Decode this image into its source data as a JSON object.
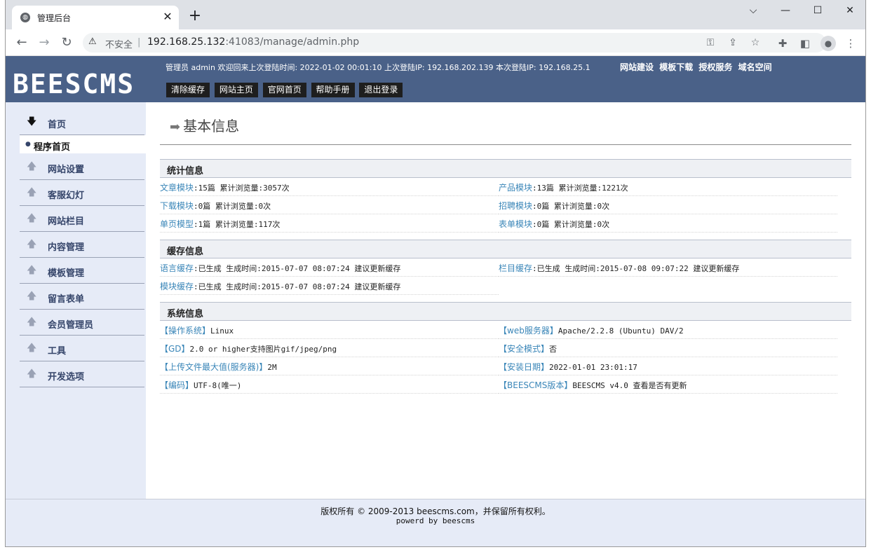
{
  "browser": {
    "tab_title": "管理后台",
    "new_tab": "+",
    "close_tab": "✕",
    "not_secure": "不安全",
    "url_host": "192.168.25.132",
    "url_rest": ":41083/manage/admin.php"
  },
  "header": {
    "logo": "BEESCMS",
    "welcome": "管理员 admin 欢迎回来上次登陆时间: 2022-01-02 00:01:10 上次登陆IP: 192.168.202.139 本次登陆IP: 192.168.25.1",
    "top_links": [
      "网站建设",
      "模板下载",
      "授权服务",
      "域名空间"
    ],
    "buttons": [
      "清除缓存",
      "网站主页",
      "官网首页",
      "帮助手册",
      "退出登录"
    ]
  },
  "sidebar": {
    "home": "首页",
    "sub_active": "程序首页",
    "items": [
      "网站设置",
      "客服幻灯",
      "网站栏目",
      "内容管理",
      "模板管理",
      "留言表单",
      "会员管理员",
      "工具",
      "开发选项"
    ]
  },
  "main": {
    "title": "基本信息",
    "stats": {
      "heading": "统计信息",
      "rows": [
        {
          "k": "文章模块",
          "v": ":15篇  累计浏览量:3057次"
        },
        {
          "k": "产品模块",
          "v": ":13篇  累计浏览量:1221次"
        },
        {
          "k": "下载模块",
          "v": ":0篇  累计浏览量:0次"
        },
        {
          "k": "招聘模块",
          "v": ":0篇  累计浏览量:0次"
        },
        {
          "k": "单页模型",
          "v": ":1篇  累计浏览量:117次"
        },
        {
          "k": "表单模块",
          "v": ":0篇  累计浏览量:0次"
        }
      ]
    },
    "cache": {
      "heading": "缓存信息",
      "rows": [
        {
          "k": "语言缓存",
          "v": ":已生成     生成时间:2015-07-07 08:07:24  建议更新缓存"
        },
        {
          "k": "栏目缓存",
          "v": ":已生成     生成时间:2015-07-08 09:07:22  建议更新缓存"
        },
        {
          "k": "模块缓存",
          "v": ":已生成     生成时间:2015-07-07 08:07:24  建议更新缓存"
        }
      ]
    },
    "system": {
      "heading": "系统信息",
      "rows": [
        {
          "k": "【操作系统】",
          "v": "Linux"
        },
        {
          "k": "【web服务器】",
          "v": "Apache/2.2.8 (Ubuntu) DAV/2"
        },
        {
          "k": "【GD】",
          "v": "2.0 or higher支持图片gif/jpeg/png"
        },
        {
          "k": "【安全模式】",
          "v": "否"
        },
        {
          "k": "【上传文件最大值(服务器)】",
          "v": "2M"
        },
        {
          "k": "【安装日期】",
          "v": "2022-01-01 23:01:17"
        },
        {
          "k": "【编码】",
          "v": "UTF-8(唯一)"
        },
        {
          "k": "【BEESCMS版本】",
          "v": "BEESCMS v4.0  查看是否有更新"
        }
      ]
    }
  },
  "footer": {
    "line1": "版权所有 © 2009-2013 beescms.com，并保留所有权利。",
    "line2": "powerd by beescms"
  }
}
